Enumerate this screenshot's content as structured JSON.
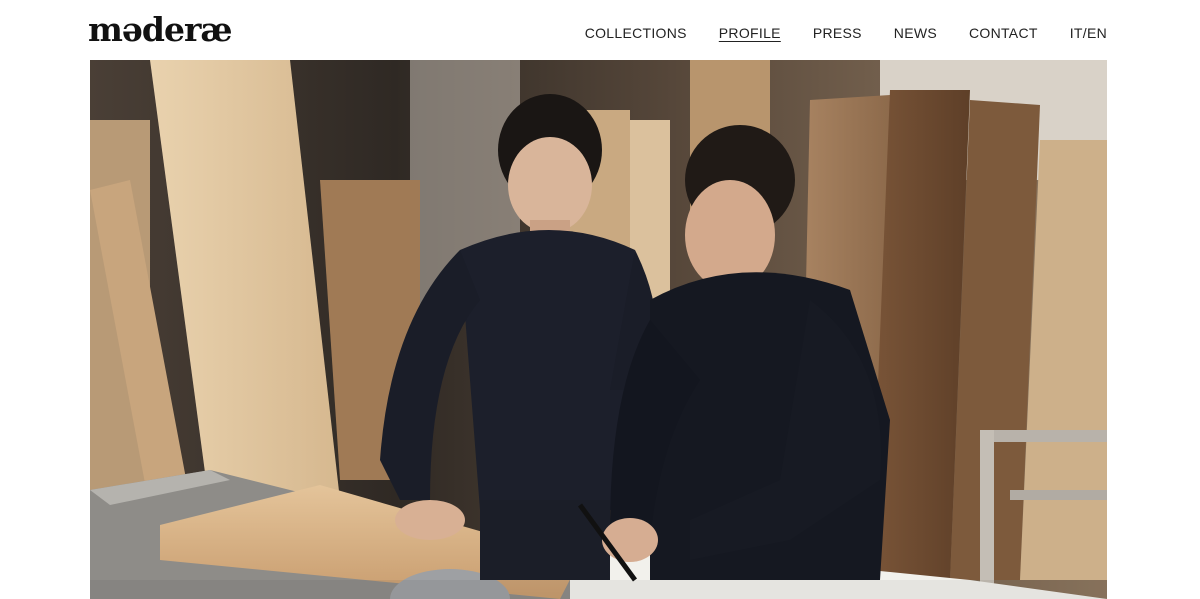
{
  "brand": {
    "logo_text": "mǝderæ"
  },
  "nav": {
    "items": [
      {
        "label": "COLLECTIONS",
        "active": false
      },
      {
        "label": "PROFILE",
        "active": true
      },
      {
        "label": "PRESS",
        "active": false
      },
      {
        "label": "NEWS",
        "active": false
      },
      {
        "label": "CONTACT",
        "active": false
      },
      {
        "label": "IT/EN",
        "active": false
      }
    ]
  },
  "hero": {
    "image_subject": "two craftsmen reviewing a drawing at a table saw in a wood workshop"
  },
  "colors": {
    "text": "#222222",
    "background": "#ffffff",
    "wood_light": "#e8cfa8",
    "wood_dark": "#6b4a30",
    "sweater": "#1c1f2b"
  }
}
